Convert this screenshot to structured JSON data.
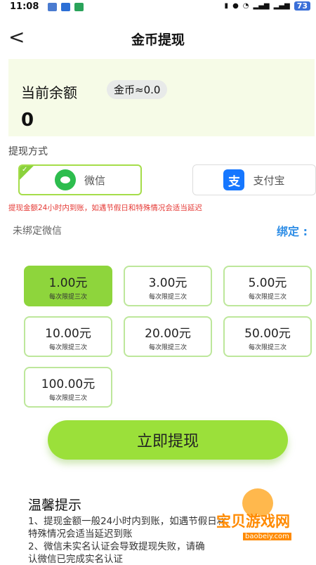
{
  "status_bar": {
    "time": "11:08",
    "battery": "73"
  },
  "header": {
    "title": "金币提现",
    "back_icon": "chevron-left-icon"
  },
  "balance": {
    "label": "当前余额",
    "coin_badge": "金币≈0.0",
    "value": "0"
  },
  "methods": {
    "title": "提现方式",
    "wechat_label": "微信",
    "alipay_label": "支付宝",
    "alipay_glyph": "支",
    "selected": "微信",
    "notice": "提现金额24小时内到账，如遇节假日和特殊情况会适当延迟"
  },
  "binding": {
    "status": "未绑定微信",
    "action": "绑定 :"
  },
  "amounts": [
    {
      "value": "1.00元",
      "note": "每次限提三次",
      "selected": true
    },
    {
      "value": "3.00元",
      "note": "每次限提三次"
    },
    {
      "value": "5.00元",
      "note": "每次限提三次"
    },
    {
      "value": "10.00元",
      "note": "每次限提三次"
    },
    {
      "value": "20.00元",
      "note": "每次限提三次"
    },
    {
      "value": "50.00元",
      "note": "每次限提三次"
    },
    {
      "value": "100.00元",
      "note": "每次限提三次"
    }
  ],
  "submit_label": "立即提现",
  "tips": {
    "title": "温馨提示",
    "line1": "1、提现金额一般24小时内到账，如遇节假日和",
    "line2": "特殊情况会适当延迟到账",
    "line3": "2、微信未实名认证会导致提现失败，请确",
    "line4": "认微信已完成实名认证"
  },
  "watermark": {
    "text": "宝贝游戏网",
    "url": "baobeiy.com"
  },
  "colors": {
    "accent_green": "#8ed53c",
    "bind_blue": "#2f8ee6",
    "notice_red": "#e53935"
  }
}
